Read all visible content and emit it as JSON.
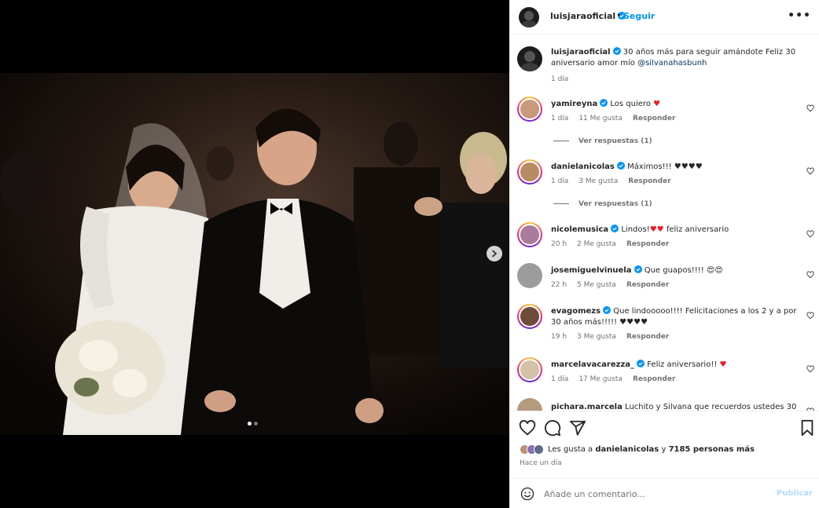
{
  "post": {
    "username": "luisjaraoficial",
    "separator": "•",
    "follow_label": "Seguir",
    "more_label": "•••"
  },
  "caption": {
    "username": "luisjaraoficial",
    "text": "30 años más para seguir amándote Feliz 30 aniversario amor mío",
    "mention": "@silvanahasbunh",
    "time": "1 día"
  },
  "comments": [
    {
      "username": "yamireyna",
      "verified": true,
      "text": "Los quiero",
      "emoji": "♥",
      "time": "1 día",
      "likes": "11 Me gusta",
      "reply": "Responder",
      "replies": "Ver respuestas (1)"
    },
    {
      "username": "danielanicolas",
      "verified": true,
      "text": "Máximos!!! ♥♥♥♥",
      "emoji": "",
      "time": "1 día",
      "likes": "3 Me gusta",
      "reply": "Responder",
      "replies": "Ver respuestas (1)"
    },
    {
      "username": "nicolemusica",
      "verified": true,
      "text": "Lindos!",
      "emoji": "♥♥",
      "text2": "feliz aniversario",
      "time": "20 h",
      "likes": "2 Me gusta",
      "reply": "Responder"
    },
    {
      "username": "josemiguelvinuela",
      "verified": true,
      "text": "Que guapos!!!! 😍😍",
      "emoji": "",
      "time": "22 h",
      "likes": "5 Me gusta",
      "reply": "Responder"
    },
    {
      "username": "evagomezs",
      "verified": true,
      "text": "Que lindooooo!!!! Felicitaciones a los 2 y a por 30 años más!!!!! ♥♥♥♥",
      "emoji": "",
      "time": "19 h",
      "likes": "3 Me gusta",
      "reply": "Responder"
    },
    {
      "username": "marcelavacarezza_",
      "verified": true,
      "text": "Feliz aniversario!!",
      "emoji": "♥",
      "time": "1 día",
      "likes": "17 Me gusta",
      "reply": "Responder"
    },
    {
      "username": "pichara.marcela",
      "verified": false,
      "text": "Luchito y Silvana que recuerdos ustedes 30",
      "emoji": ""
    }
  ],
  "likes": {
    "prefix": "Les gusta a",
    "user": "danielanicolas",
    "middle": "y",
    "count": "7185 personas más"
  },
  "timestamp": "Hace un día",
  "composer": {
    "placeholder": "Añade un comentario...",
    "publish_label": "Publicar"
  },
  "colors": {
    "link_blue": "#0095f6",
    "heart_red": "#ed1c24",
    "muted": "#737373"
  }
}
